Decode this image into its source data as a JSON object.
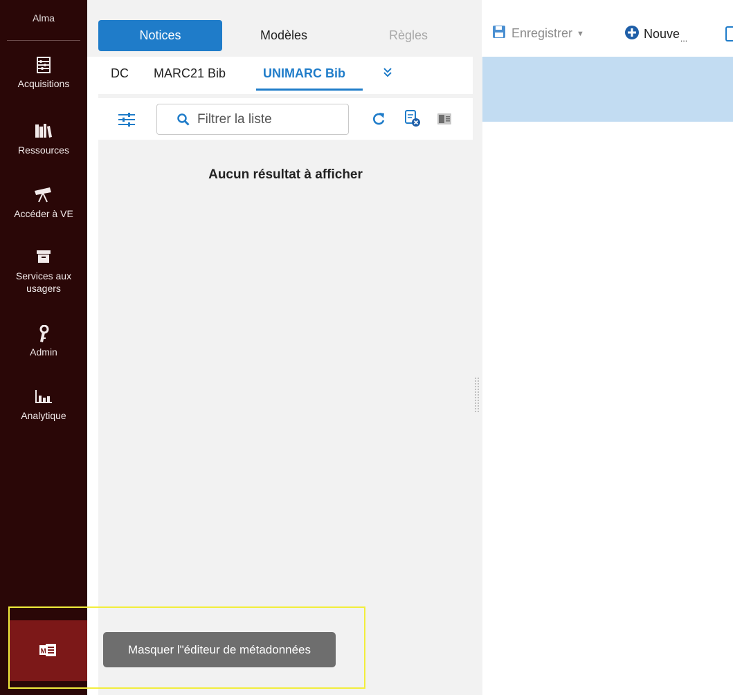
{
  "sidebar": {
    "brand": "Alma",
    "items": [
      {
        "label": "Acquisitions",
        "icon": "abacus-icon"
      },
      {
        "label": "Ressources",
        "icon": "books-icon"
      },
      {
        "label": "Accéder à VE",
        "icon": "telescope-icon"
      },
      {
        "label": "Services aux usagers",
        "icon": "archive-box-icon"
      },
      {
        "label": "Admin",
        "icon": "key-icon"
      },
      {
        "label": "Analytique",
        "icon": "bar-chart-icon"
      }
    ],
    "editor_icon": "metadata-editor-icon"
  },
  "top_tabs": {
    "notices": "Notices",
    "modeles": "Modèles",
    "regles": "Règles"
  },
  "toolbar": {
    "save_label": "Enregistrer",
    "new_label": "Nouve",
    "new_ellipsis": "..."
  },
  "format_tabs": {
    "dc": "DC",
    "marc21": "MARC21 Bib",
    "unimarc": "UNIMARC Bib"
  },
  "filter": {
    "placeholder": "Filtrer la liste",
    "value": ""
  },
  "results": {
    "empty_message": "Aucun résultat à afficher"
  },
  "tooltip": {
    "text": "Masquer l\"éditeur de métadonnées"
  },
  "colors": {
    "sidebar_bg": "#2a0707",
    "accent": "#1f7cc9",
    "editor_button": "#7c1818",
    "editor_header": "#c2dcf2",
    "highlight": "#f2ee3c"
  }
}
